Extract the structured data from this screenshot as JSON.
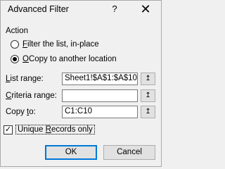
{
  "window": {
    "title": "Advanced Filter",
    "help_label": "?",
    "close_label": "✕"
  },
  "action": {
    "label": "Action",
    "options": [
      {
        "prefix": "",
        "accel": "F",
        "rest": "ilter the list, in-place",
        "selected": false
      },
      {
        "prefix": "",
        "accel": "O",
        "rest": "Copy to another location",
        "selected": true
      }
    ]
  },
  "fields": {
    "list_range": {
      "accel": "L",
      "rest": "ist range:",
      "value": "Sheet1!$A$1:$A$10"
    },
    "criteria_range": {
      "accel": "C",
      "rest": "riteria range:",
      "value": ""
    },
    "copy_to": {
      "prefix": "Copy ",
      "accel": "t",
      "rest": "o:",
      "value": "C1:C10"
    },
    "collapse_icon": "↥"
  },
  "unique": {
    "accel": "R",
    "prefix": "Unique ",
    "rest": "ecords only",
    "checked": true,
    "check_glyph": "✓"
  },
  "buttons": {
    "ok_label": "OK",
    "cancel_label": "Cancel"
  },
  "colors": {
    "accent": "#0078d7",
    "background": "#f0f0f0"
  }
}
